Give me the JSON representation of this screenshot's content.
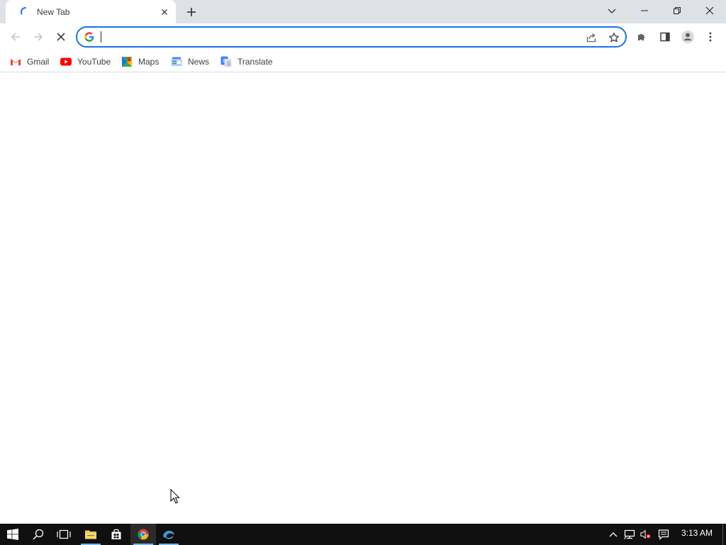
{
  "browser": {
    "tab": {
      "title": "New Tab",
      "loading": true
    },
    "window_controls": [
      "tab-search",
      "minimize",
      "restore",
      "close"
    ],
    "toolbar": {
      "omnibox": {
        "value": "",
        "placeholder": "",
        "search_engine_icon": "google-g-icon"
      },
      "nav_buttons": [
        "back",
        "forward",
        "stop"
      ],
      "right_buttons": [
        "share",
        "bookmark-star",
        "extensions",
        "side-panel",
        "profile",
        "menu"
      ]
    },
    "bookmarks": [
      {
        "label": "Gmail",
        "icon": "gmail-icon"
      },
      {
        "label": "YouTube",
        "icon": "youtube-icon"
      },
      {
        "label": "Maps",
        "icon": "maps-icon"
      },
      {
        "label": "News",
        "icon": "news-icon"
      },
      {
        "label": "Translate",
        "icon": "translate-icon"
      }
    ]
  },
  "taskbar": {
    "clock": "3:13 AM",
    "pinned": [
      "start",
      "search",
      "task-view",
      "file-explorer",
      "store",
      "chrome",
      "edge"
    ]
  },
  "colors": {
    "accent": "#1a73e8",
    "tabstrip": "#dee1e6",
    "taskbar": "#101010"
  }
}
